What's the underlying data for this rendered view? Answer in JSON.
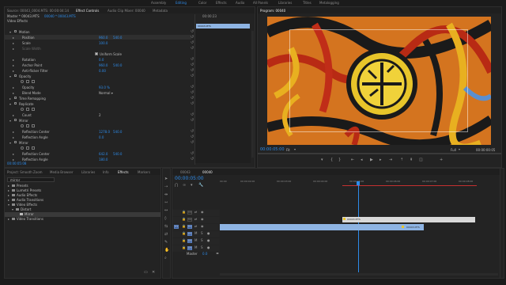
{
  "workspaces": [
    {
      "label": "Assembly",
      "active": false
    },
    {
      "label": "Editing",
      "active": true
    },
    {
      "label": "Color",
      "active": false
    },
    {
      "label": "Effects",
      "active": false
    },
    {
      "label": "Audio",
      "active": false
    },
    {
      "label": "All Panels",
      "active": false
    },
    {
      "label": "Libraries",
      "active": false
    },
    {
      "label": "Titles",
      "active": false
    },
    {
      "label": "Metalogging",
      "active": false
    }
  ],
  "source_panel": {
    "tabs": [
      "Source: 00043_0004.MTS: 00:00:04:14",
      "Effect Controls",
      "Audio Clip Mixer: 00040",
      "Metadata"
    ],
    "breadcrumb": "Master * 00043.MTS",
    "clip_name": "00040 * 00043.MTS",
    "video_effects_label": "Video Effects",
    "mini_tc": "00:00:23",
    "mini_clip": "00043.MTS",
    "rows": [
      {
        "label": "Motion",
        "value": "",
        "indent": 0,
        "expanded": true
      },
      {
        "label": "Position",
        "value": "960.0",
        "value2": "540.0",
        "indent": 1,
        "highlight": true
      },
      {
        "label": "Scale",
        "value": "100.0",
        "value2": "",
        "indent": 1
      },
      {
        "label": "Scale Width",
        "value": "",
        "value2": "",
        "indent": 1,
        "dim": true
      },
      {
        "label": "Uniform Scale",
        "value": "",
        "value2": "",
        "indent": 2,
        "checkbox": true
      },
      {
        "label": "Rotation",
        "value": "0.0",
        "value2": "",
        "indent": 1
      },
      {
        "label": "Anchor Point",
        "value": "960.0",
        "value2": "540.0",
        "indent": 1
      },
      {
        "label": "Anti-flicker Filter",
        "value": "0.00",
        "value2": "",
        "indent": 1
      },
      {
        "label": "Opacity",
        "value": "",
        "value2": "",
        "indent": 0,
        "expanded": true
      },
      {
        "label": "",
        "value": "",
        "value2": "",
        "indent": 1,
        "masks": true
      },
      {
        "label": "Opacity",
        "value": "93.0 %",
        "value2": "",
        "indent": 1
      },
      {
        "label": "Blend Mode",
        "value": "Normal",
        "value2": "",
        "indent": 1,
        "dropdown": true
      },
      {
        "label": "Time Remapping",
        "value": "",
        "value2": "",
        "indent": 0
      },
      {
        "label": "Replicate",
        "value": "",
        "value2": "",
        "indent": 0,
        "expanded": true
      },
      {
        "label": "",
        "value": "",
        "value2": "",
        "indent": 1,
        "masks": true
      },
      {
        "label": "Count",
        "value": "2",
        "value2": "",
        "indent": 1,
        "whiteval": true
      },
      {
        "label": "Mirror",
        "value": "",
        "value2": "",
        "indent": 0,
        "expanded": true
      },
      {
        "label": "",
        "value": "",
        "value2": "",
        "indent": 1,
        "masks": true
      },
      {
        "label": "Reflection Center",
        "value": "1278.0",
        "value2": "540.0",
        "indent": 1
      },
      {
        "label": "Reflection Angle",
        "value": "0.0",
        "value2": "",
        "indent": 1
      },
      {
        "label": "Mirror",
        "value": "",
        "value2": "",
        "indent": 0,
        "expanded": true
      },
      {
        "label": "",
        "value": "",
        "value2": "",
        "indent": 1,
        "masks": true
      },
      {
        "label": "Reflection Center",
        "value": "642.0",
        "value2": "540.0",
        "indent": 1
      },
      {
        "label": "Reflection Angle",
        "value": "180.0",
        "value2": "",
        "indent": 1
      }
    ],
    "footer_tc": "00:00:05:08"
  },
  "program_panel": {
    "title": "Program: 00040",
    "timecode": "00:00:05:00",
    "fit": "Fit",
    "quality": "Full",
    "duration": "00:00:00:05"
  },
  "effects_panel": {
    "tabs": [
      "Project: Smooth Zoom",
      "Media Browser",
      "Libraries",
      "Info",
      "Effects",
      "Markers"
    ],
    "search_value": "mirror",
    "tree": [
      {
        "label": "Presets",
        "indent": 0
      },
      {
        "label": "Lumetri Presets",
        "indent": 0
      },
      {
        "label": "Audio Effects",
        "indent": 0
      },
      {
        "label": "Audio Transitions",
        "indent": 0
      },
      {
        "label": "Video Effects",
        "indent": 0,
        "expanded": true
      },
      {
        "label": "Distort",
        "indent": 1,
        "expanded": true
      },
      {
        "label": "Mirror",
        "indent": 2,
        "selected": true
      },
      {
        "label": "Video Transitions",
        "indent": 0
      }
    ]
  },
  "timeline": {
    "tabs": [
      "00043",
      "00040"
    ],
    "timecode": "00:00:05:00",
    "ruler": [
      "00:00",
      "00:00:02:00",
      "00:00:03:00",
      "00:00:04:00",
      "00:00:05:00",
      "00:00:06:00",
      "00:00:07:00",
      "00:00:08:00"
    ],
    "video_tracks": [
      "V3",
      "V2",
      "V1"
    ],
    "audio_tracks": [
      "A1",
      "A2",
      "A3"
    ],
    "master_label": "Master",
    "master_value": "0.0",
    "clip_v2": "00043.MTS",
    "clip_v1": "00043.MTS"
  },
  "colors": {
    "accent": "#2d8ceb",
    "clip_v1": "#8eb4e3",
    "clip_v2": "#d8d8d8"
  }
}
